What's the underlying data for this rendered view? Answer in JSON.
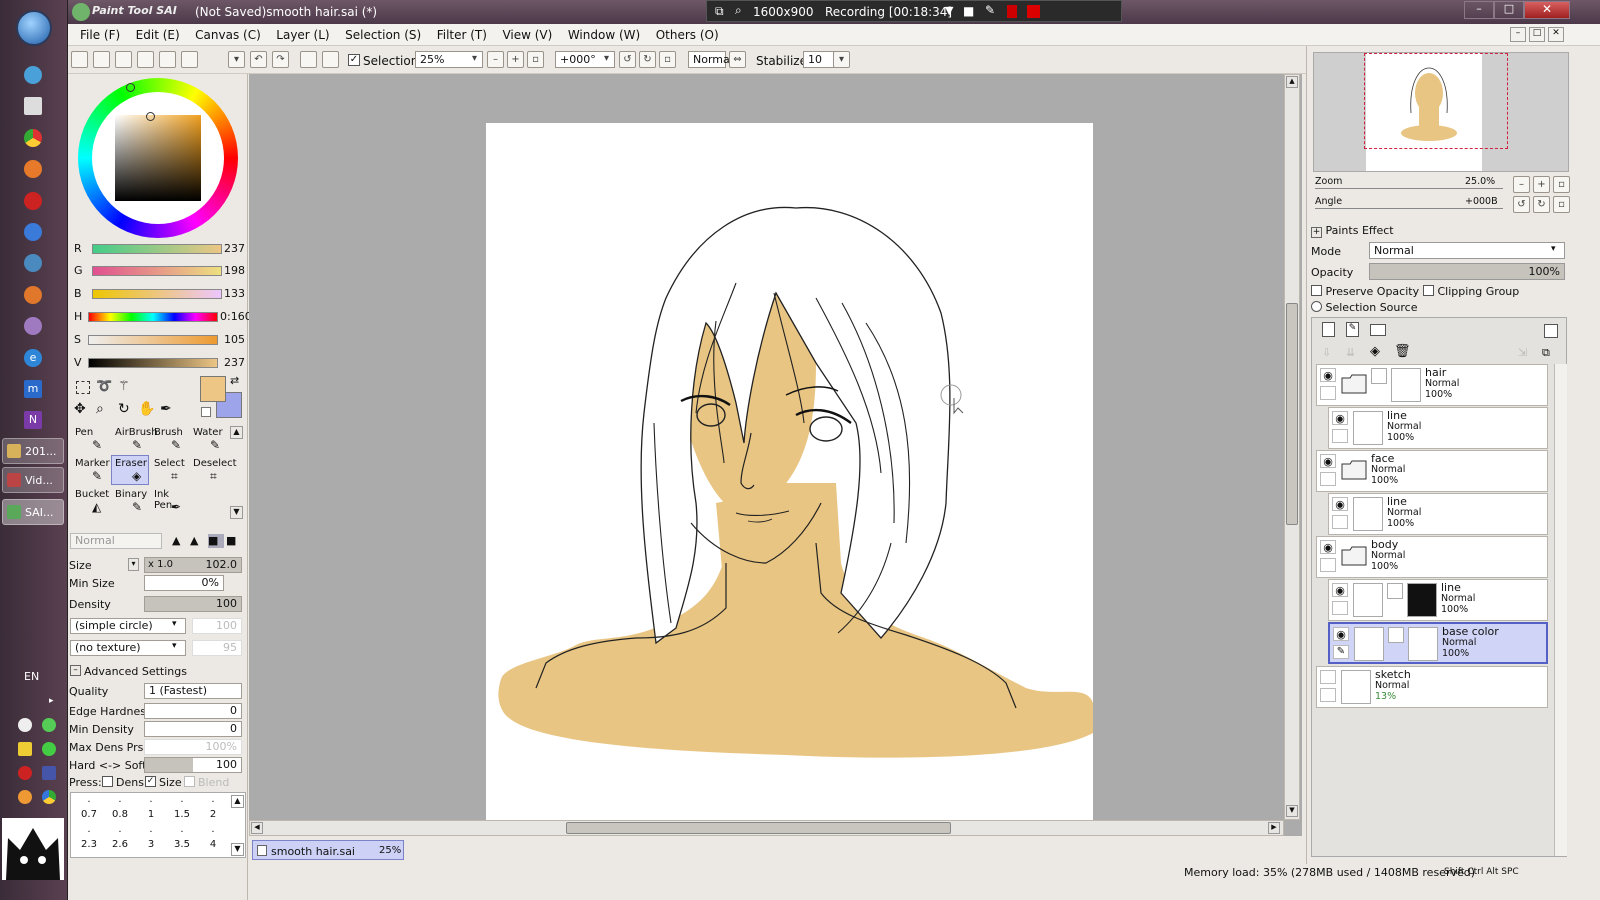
{
  "window": {
    "app_name": "Paint Tool SAI",
    "title": "(Not Saved)smooth hair.sai (*)"
  },
  "recorder": {
    "resolution": "1600x900",
    "recording": "Recording [00:18:34]"
  },
  "taskbar": {
    "tasks": [
      {
        "label": "201..."
      },
      {
        "label": "Vid..."
      },
      {
        "label": "SAI..."
      }
    ],
    "lang": "EN"
  },
  "menu": [
    "File (F)",
    "Edit (E)",
    "Canvas (C)",
    "Layer (L)",
    "Selection (S)",
    "Filter (T)",
    "View (V)",
    "Window (W)",
    "Others (O)"
  ],
  "toolbar": {
    "selection_label": "Selection",
    "zoom": "25%",
    "rotation": "+000°",
    "blend": "Normal",
    "stabilizer_label": "Stabilizer",
    "stabilizer_value": "10"
  },
  "color": {
    "sliders": [
      {
        "label": "R",
        "value": "237"
      },
      {
        "label": "G",
        "value": "198"
      },
      {
        "label": "B",
        "value": "133"
      },
      {
        "label": "H",
        "value": "0:160"
      },
      {
        "label": "S",
        "value": "105"
      },
      {
        "label": "V",
        "value": "237"
      }
    ],
    "primary": "#edc685",
    "secondary": "#9ea4ea"
  },
  "tools": [
    {
      "label": "Pen"
    },
    {
      "label": "AirBrush"
    },
    {
      "label": "Brush"
    },
    {
      "label": "Water"
    },
    {
      "label": "Marker"
    },
    {
      "label": "Eraser"
    },
    {
      "label": "Select"
    },
    {
      "label": "Deselect"
    },
    {
      "label": "Bucket"
    },
    {
      "label": "Binary"
    },
    {
      "label": "Ink Pen"
    }
  ],
  "brush": {
    "mode": "Normal",
    "size_label": "Size",
    "size_mult": "x 1.0",
    "size_value": "102.0",
    "minsize_label": "Min Size",
    "minsize_value": "0%",
    "density_label": "Density",
    "density_value": "100",
    "shape": "(simple circle)",
    "shape_val": "100",
    "texture": "(no texture)",
    "texture_val": "95",
    "advanced_label": "Advanced Settings",
    "quality_label": "Quality",
    "quality_value": "1 (Fastest)",
    "edge_label": "Edge Hardness",
    "edge_value": "0",
    "mindens_label": "Min Density",
    "mindens_value": "0",
    "maxdens_label": "Max Dens Prs.",
    "maxdens_value": "100%",
    "hardsoft_label": "Hard <-> Soft",
    "hardsoft_value": "100",
    "press_label": "Press:",
    "dens_label": "Dens",
    "size2_label": "Size",
    "blend_label": "Blend",
    "presets_row1": [
      "0.7",
      "0.8",
      "1",
      "1.5",
      "2"
    ],
    "presets_row2": [
      "2.3",
      "2.6",
      "3",
      "3.5",
      "4"
    ]
  },
  "tab": {
    "name": "smooth hair.sai",
    "zoom": "25%"
  },
  "navigator": {
    "zoom_label": "Zoom",
    "zoom_value": "25.0%",
    "angle_label": "Angle",
    "angle_value": "+000B"
  },
  "layerprops": {
    "paints_effect": "Paints Effect",
    "mode_label": "Mode",
    "mode_value": "Normal",
    "opacity_label": "Opacity",
    "opacity_value": "100%",
    "preserve": "Preserve Opacity",
    "clipping": "Clipping Group",
    "selsource": "Selection Source"
  },
  "layers": [
    {
      "name": "hair",
      "mode": "Normal",
      "opacity": "100%",
      "type": "folder"
    },
    {
      "name": "line",
      "mode": "Normal",
      "opacity": "100%",
      "type": "layer"
    },
    {
      "name": "face",
      "mode": "Normal",
      "opacity": "100%",
      "type": "folder"
    },
    {
      "name": "line",
      "mode": "Normal",
      "opacity": "100%",
      "type": "layer"
    },
    {
      "name": "body",
      "mode": "Normal",
      "opacity": "100%",
      "type": "folder"
    },
    {
      "name": "line",
      "mode": "Normal",
      "opacity": "100%",
      "type": "layer"
    },
    {
      "name": "base color",
      "mode": "Normal",
      "opacity": "100%",
      "type": "layer"
    },
    {
      "name": "sketch",
      "mode": "Normal",
      "opacity": "13%",
      "type": "layer"
    }
  ],
  "status": {
    "memory": "Memory load: 35% (278MB used / 1408MB reserved)",
    "keys": "Shift Ctrl Alt SPC"
  },
  "skin_color": "#e8c583"
}
